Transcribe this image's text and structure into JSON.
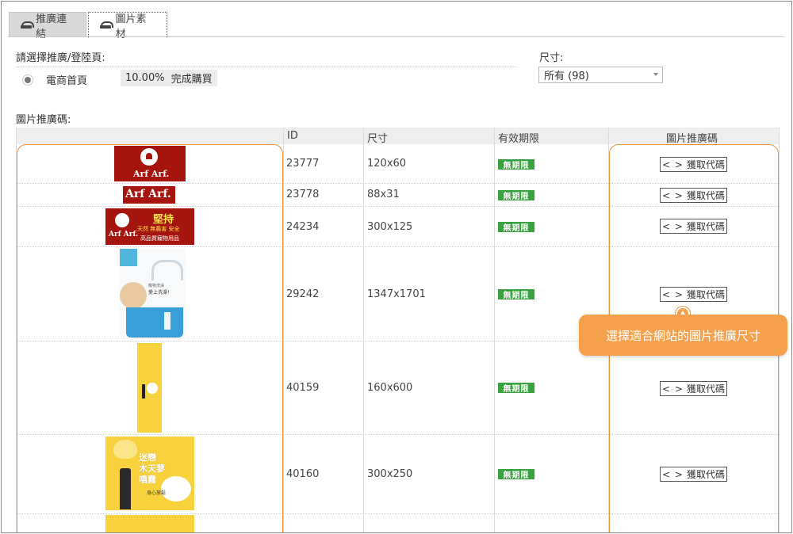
{
  "tabs": [
    {
      "label": "推廣連結",
      "icon": "link-icon",
      "active": false
    },
    {
      "label": "圖片素材",
      "icon": "image-icon",
      "active": true
    }
  ],
  "landing": {
    "title": "請選擇推廣/登陸頁:",
    "page_name": "電商首頁",
    "rate": "10.00%",
    "action": "完成購買"
  },
  "size_filter": {
    "label": "尺寸:",
    "selected": "所有 (98)"
  },
  "image_codes": {
    "title": "圖片推廣碼:",
    "columns": {
      "id": "ID",
      "size": "尺寸",
      "expiry": "有效期限",
      "code": "圖片推廣碼"
    },
    "button_prefix": "< >",
    "button_label": "獲取代碼",
    "rows": [
      {
        "id": "23777",
        "size": "120x60",
        "expiry": "無期限"
      },
      {
        "id": "23778",
        "size": "88x31",
        "expiry": "無期限"
      },
      {
        "id": "24234",
        "size": "300x125",
        "expiry": "無期限"
      },
      {
        "id": "29242",
        "size": "1347x1701",
        "expiry": "無期限"
      },
      {
        "id": "40159",
        "size": "160x600",
        "expiry": "無期限"
      },
      {
        "id": "40160",
        "size": "300x250",
        "expiry": "無期限"
      }
    ]
  },
  "banners": {
    "brand": "Arf Arf.",
    "b3_title": "堅持",
    "b3_line": "天然 無農害 安全",
    "b3_sub": "高品質寵物用品",
    "b4_text1": "寵物洗澡",
    "b4_text2": "愛上洗澡！",
    "b6_title1": "迷戀",
    "b6_title2": "木天蓼",
    "b6_title3": "噴霧",
    "b6_sub": "身心放鬆"
  },
  "callout": {
    "text": "選擇適合網站的圖片推廣尺寸"
  },
  "colors": {
    "accent_orange": "#f5a04c",
    "badge_green": "#3aa241",
    "brand_red": "#a5150d",
    "banner_yellow": "#f7d23c"
  }
}
